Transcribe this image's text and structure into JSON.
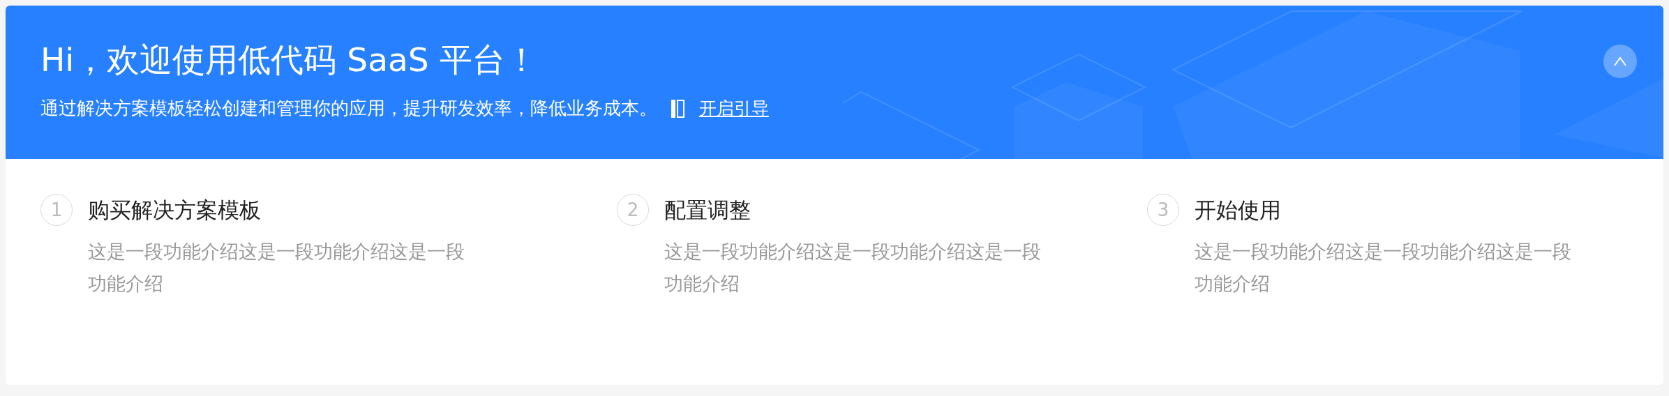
{
  "banner": {
    "title": "Hi，欢迎使用低代码 SaaS 平台！",
    "subtitle": "通过解决方案模板轻松创建和管理你的应用，提升研发效率，降低业务成本。",
    "guide_link": "开启引导"
  },
  "steps": [
    {
      "number": "1",
      "title": "购买解决方案模板",
      "description": "这是一段功能介绍这是一段功能介绍这是一段功能介绍"
    },
    {
      "number": "2",
      "title": "配置调整",
      "description": "这是一段功能介绍这是一段功能介绍这是一段功能介绍"
    },
    {
      "number": "3",
      "title": "开始使用",
      "description": "这是一段功能介绍这是一段功能介绍这是一段功能介绍"
    }
  ]
}
